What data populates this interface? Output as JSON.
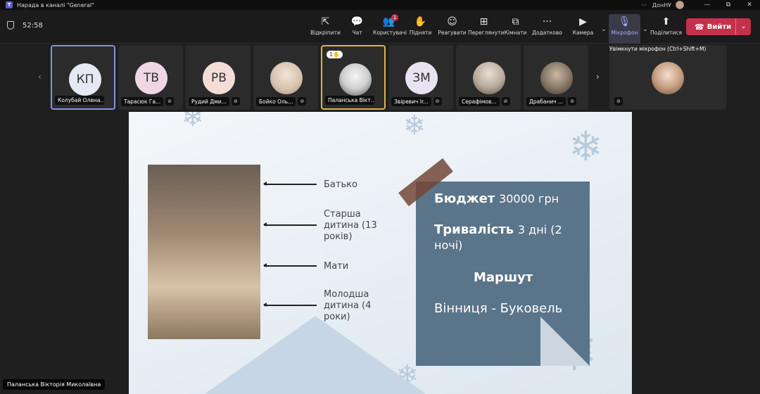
{
  "window": {
    "title": "Нарада в каналі \"General\"",
    "more": "···",
    "org": "ДонНУ",
    "min": "—",
    "max": "⧉",
    "close": "✕"
  },
  "meeting": {
    "timer": "52:58",
    "tools": [
      {
        "label": "Відкріпити",
        "icon": "⇱"
      },
      {
        "label": "Чат",
        "icon": "💬"
      },
      {
        "label": "Користувачі",
        "icon": "👥",
        "badge": "1"
      },
      {
        "label": "Підняти",
        "icon": "✋"
      },
      {
        "label": "Реагувати",
        "icon": "☺"
      },
      {
        "label": "Переглянути",
        "icon": "⊞"
      },
      {
        "label": "Кімнати",
        "icon": "⧉"
      },
      {
        "label": "Додатково",
        "icon": "···"
      }
    ],
    "camera_label": "Камера",
    "mic_label": "Мікрофон",
    "share_label": "Поділитися",
    "leave_label": "Вийти"
  },
  "participants": [
    {
      "initials": "КП",
      "name": "Колубай Олена...",
      "color": "#e6e8f4",
      "photo": false,
      "muted": false
    },
    {
      "initials": "ТВ",
      "name": "Тарасюк Га...",
      "color": "#eed7e2",
      "photo": false,
      "muted": true
    },
    {
      "initials": "РВ",
      "name": "Рудий Дми...",
      "color": "#f3ddd6",
      "photo": false,
      "muted": true
    },
    {
      "initials": "",
      "name": "Бойко Оль...",
      "color": "#d8c3b0",
      "photo": true,
      "muted": true
    },
    {
      "initials": "",
      "name": "Паланська Вікт...",
      "color": "#cfcfcf",
      "photo": true,
      "muted": false,
      "hand": "1✋"
    },
    {
      "initials": "ЗМ",
      "name": "Звіревич Ir...",
      "color": "#e7e3f0",
      "photo": false,
      "muted": true
    },
    {
      "initials": "",
      "name": "Серафімов...",
      "color": "#b7a99a",
      "photo": true,
      "muted": true
    },
    {
      "initials": "",
      "name": "Драбанич ...",
      "color": "#8a7a6a",
      "photo": true,
      "muted": true
    }
  ],
  "tooltip": "Увімкнути мікрофон (Ctrl+Shift+M)",
  "slide": {
    "labels": [
      {
        "text": "Батько"
      },
      {
        "text": "Старша дитина (13 років)"
      },
      {
        "text": "Мати"
      },
      {
        "text": "Молодша дитина (4 роки)"
      }
    ],
    "budget_label": "Бюджет",
    "budget_value": "30000 грн",
    "duration_label": "Тривалість",
    "duration_value": "3 дні (2 ночі)",
    "route_label": "Маршут",
    "route_value": "Вінниця - Буковель"
  },
  "presenter_name": "Паланська Вікторія Миколаївна"
}
